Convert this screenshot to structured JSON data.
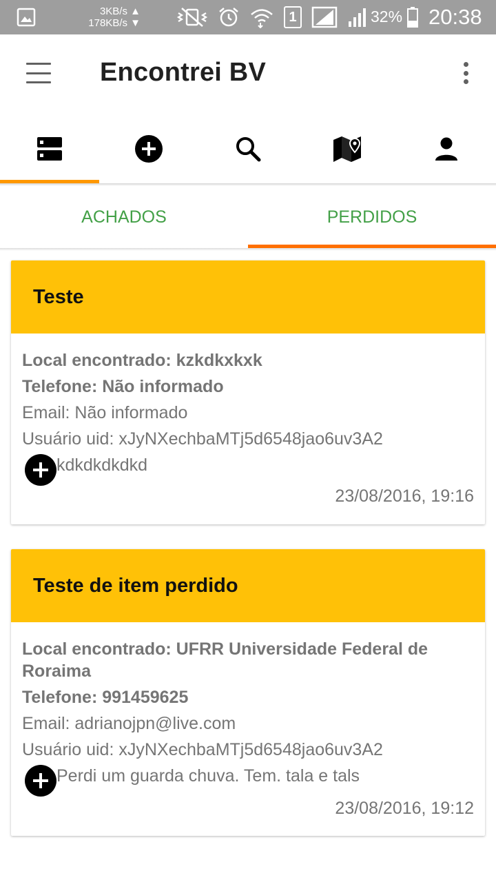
{
  "status_bar": {
    "speed_up": "3KB/s ▲",
    "speed_down": "178KB/s ▼",
    "sim_label": "1",
    "battery": "32%",
    "time": "20:38"
  },
  "app_bar": {
    "title": "Encontrei BV",
    "menu_icon": "hamburger-menu-icon",
    "overflow_icon": "more-vertical-icon"
  },
  "icon_tabs": [
    {
      "icon": "list-icon",
      "active": true
    },
    {
      "icon": "add-circle-icon",
      "active": false
    },
    {
      "icon": "search-icon",
      "active": false
    },
    {
      "icon": "map-pin-icon",
      "active": false
    },
    {
      "icon": "person-icon",
      "active": false
    }
  ],
  "text_tabs": {
    "found": "ACHADOS",
    "lost": "PERDIDOS",
    "active": "PERDIDOS"
  },
  "cards": [
    {
      "title": "Teste",
      "local": "Local encontrado: kzkdkxkxk",
      "phone": "Telefone: Não informado",
      "email": "Email: Não informado",
      "uid": "Usuário uid: xJyNXechbaMTj5d6548jao6uv3A2",
      "description": "kdkdkdkdkd",
      "timestamp": "23/08/2016, 19:16"
    },
    {
      "title": "Teste de item perdido",
      "local": "Local encontrado: UFRR Universidade Federal de Roraima",
      "phone": "Telefone: 991459625",
      "email": "Email: adrianojpn@live.com",
      "uid": "Usuário uid: xJyNXechbaMTj5d6548jao6uv3A2",
      "description": "Perdi um guarda chuva. Tem. tala e tals",
      "timestamp": "23/08/2016, 19:12"
    }
  ],
  "colors": {
    "header_yellow": "#ffc107",
    "tab_green": "#43a047",
    "indicator_orange": "#ff9800",
    "status_bar_gray": "#9e9e9e"
  }
}
